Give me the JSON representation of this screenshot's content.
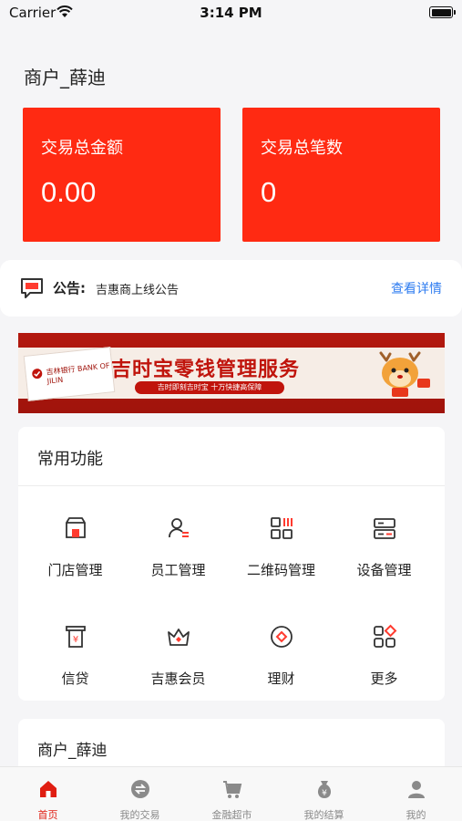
{
  "status_bar": {
    "carrier": "Carrier",
    "time": "3:14 PM"
  },
  "header": {
    "merchant_title": "商户_薛迪"
  },
  "stats": [
    {
      "label": "交易总金额",
      "value": "0.00"
    },
    {
      "label": "交易总笔数",
      "value": "0"
    }
  ],
  "notice": {
    "label": "公告:",
    "text": "吉惠商上线公告",
    "link": "查看详情"
  },
  "banner": {
    "title": "吉时宝零钱管理服务",
    "subtitle": "吉时即刻吉时宝 十万快捷高保障",
    "bank_text": "吉林银行 BANK OF JILIN"
  },
  "functions": {
    "title": "常用功能",
    "items": [
      {
        "label": "门店管理",
        "icon": "store-icon"
      },
      {
        "label": "员工管理",
        "icon": "staff-icon"
      },
      {
        "label": "二维码管理",
        "icon": "qrcode-icon"
      },
      {
        "label": "设备管理",
        "icon": "device-icon"
      },
      {
        "label": "信贷",
        "icon": "credit-icon"
      },
      {
        "label": "吉惠会员",
        "icon": "crown-icon"
      },
      {
        "label": "理财",
        "icon": "finance-icon"
      },
      {
        "label": "更多",
        "icon": "more-icon"
      }
    ]
  },
  "merchant_card": {
    "title": "商户_薛迪"
  },
  "tabbar": {
    "items": [
      {
        "label": "首页",
        "icon": "home-icon",
        "active": true
      },
      {
        "label": "我的交易",
        "icon": "transaction-icon",
        "active": false
      },
      {
        "label": "金融超市",
        "icon": "cart-icon",
        "active": false
      },
      {
        "label": "我的结算",
        "icon": "moneybag-icon",
        "active": false
      },
      {
        "label": "我的",
        "icon": "user-icon",
        "active": false
      }
    ]
  },
  "colors": {
    "brand_red": "#ff2a12",
    "link_blue": "#2e7cf0",
    "tab_active": "#e01e12",
    "tab_inactive": "#8a8a8a"
  }
}
